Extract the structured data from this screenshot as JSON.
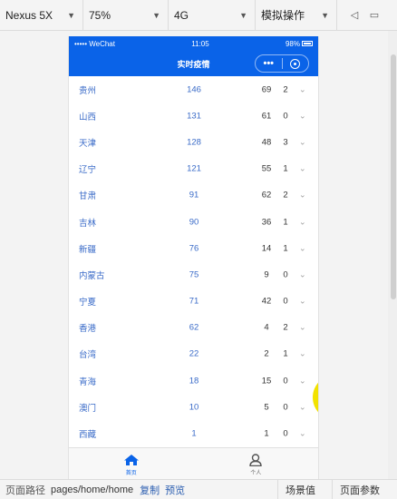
{
  "toolbar": {
    "device": "Nexus 5X",
    "zoom": "75%",
    "network": "4G",
    "mode": "模拟操作"
  },
  "phone": {
    "statusbar": {
      "carrier": "••••• WeChat",
      "time": "11:05",
      "battery": "98%"
    },
    "navbar": {
      "title": "实时疫情",
      "menu_dots": "•••"
    },
    "rows": [
      {
        "name": "贵州",
        "a": "146",
        "b": "69",
        "c": "2"
      },
      {
        "name": "山西",
        "a": "131",
        "b": "61",
        "c": "0"
      },
      {
        "name": "天津",
        "a": "128",
        "b": "48",
        "c": "3"
      },
      {
        "name": "辽宁",
        "a": "121",
        "b": "55",
        "c": "1"
      },
      {
        "name": "甘肃",
        "a": "91",
        "b": "62",
        "c": "2"
      },
      {
        "name": "吉林",
        "a": "90",
        "b": "36",
        "c": "1"
      },
      {
        "name": "新疆",
        "a": "76",
        "b": "14",
        "c": "1"
      },
      {
        "name": "内蒙古",
        "a": "75",
        "b": "9",
        "c": "0"
      },
      {
        "name": "宁夏",
        "a": "71",
        "b": "42",
        "c": "0"
      },
      {
        "name": "香港",
        "a": "62",
        "b": "4",
        "c": "2"
      },
      {
        "name": "台湾",
        "a": "22",
        "b": "2",
        "c": "1"
      },
      {
        "name": "青海",
        "a": "18",
        "b": "15",
        "c": "0"
      },
      {
        "name": "澳门",
        "a": "10",
        "b": "5",
        "c": "0"
      },
      {
        "name": "西藏",
        "a": "1",
        "b": "1",
        "c": "0"
      }
    ],
    "row_arrow": "⌄",
    "tabs": [
      {
        "label": "首页",
        "icon": "home-icon"
      },
      {
        "label": "个人",
        "icon": "person-icon"
      }
    ]
  },
  "bottom": {
    "path_label": "页面路径",
    "path": "pages/home/home",
    "copy": "复制",
    "preview": "预览",
    "scene": "场景值",
    "params": "页面参数"
  },
  "colors": {
    "brand_blue": "#0a63e8",
    "link_blue": "#3a6bc8",
    "cursor_yellow": "#f2e200"
  }
}
